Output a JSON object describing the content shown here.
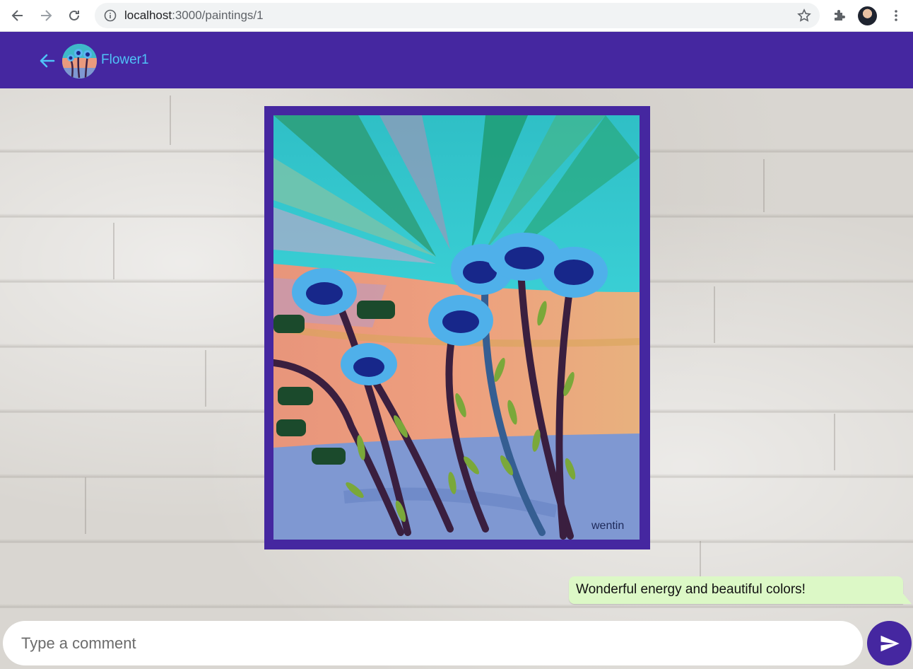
{
  "browser": {
    "url_host": "localhost",
    "url_path": ":3000/paintings/1",
    "icons": {
      "back": "arrow-left-icon",
      "forward": "arrow-right-icon",
      "reload": "reload-icon",
      "site_info": "info-icon",
      "bookmark": "star-icon",
      "extensions": "puzzle-icon",
      "profile": "avatar",
      "menu": "kebab-menu-icon"
    }
  },
  "header": {
    "title": "Flower1",
    "back_icon": "arrow-left-icon",
    "background": "#4527a0",
    "title_color": "#4fc3f7"
  },
  "painting": {
    "frame_color": "#4527a0",
    "signature": "wentin"
  },
  "comments": [
    {
      "text": "Wonderful energy and beautiful colors!",
      "bubble_color": "#dcf8c6"
    }
  ],
  "composer": {
    "placeholder": "Type a comment",
    "send_icon": "send-icon"
  }
}
